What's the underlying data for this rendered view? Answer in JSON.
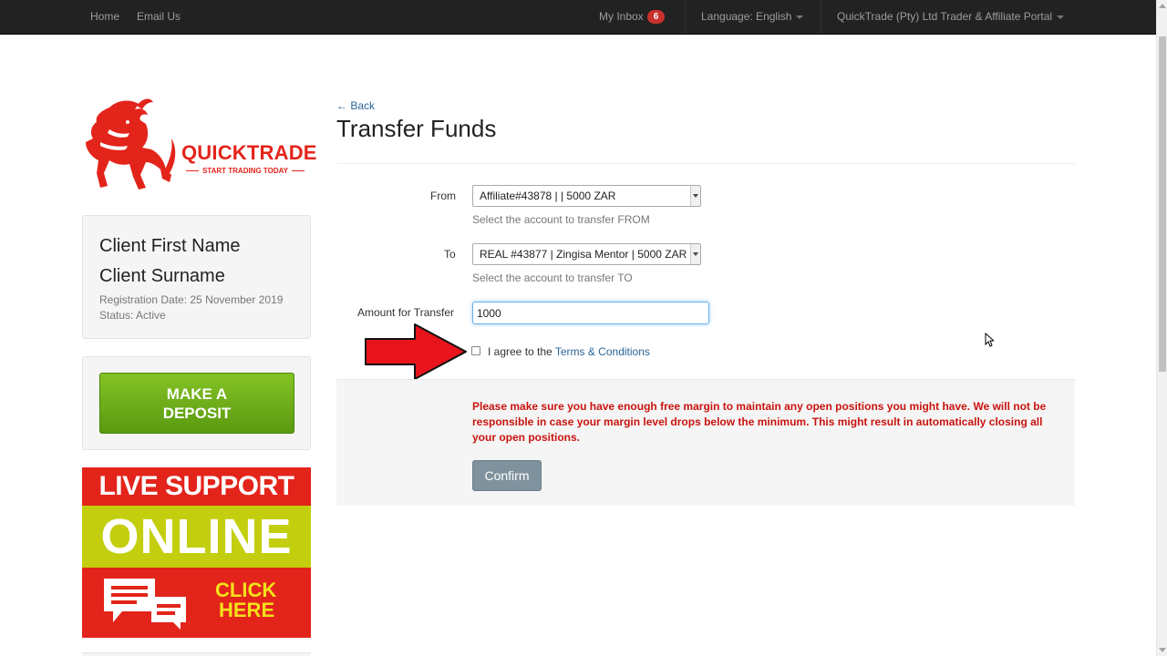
{
  "navbar": {
    "home": "Home",
    "email_us": "Email Us",
    "inbox_label": "My Inbox",
    "inbox_count": "6",
    "language": "Language: English",
    "portal": "QuickTrade (Pty) Ltd Trader & Affiliate Portal"
  },
  "sidebar": {
    "logo_text": "QUICKTRADE",
    "logo_tagline": "START TRADING TODAY",
    "client": {
      "first_name": "Client First Name",
      "surname": "Client Surname",
      "registration": "Registration Date: 25 November 2019",
      "status": "Status: Active"
    },
    "deposit_line1": "MAKE A",
    "deposit_line2": "DEPOSIT",
    "support_line1": "LIVE SUPPORT",
    "support_line2": "ONLINE",
    "support_click1": "CLICK",
    "support_click2": "HERE"
  },
  "main": {
    "back": "← Back",
    "title": "Transfer Funds",
    "from_label": "From",
    "from_value": "Affiliate#43878 | | 5000 ZAR",
    "from_help": "Select the account to transfer FROM",
    "to_label": "To",
    "to_value": "REAL #43877 | Zingisa Mentor | 5000 ZAR",
    "to_help": "Select the account to transfer TO",
    "amount_label": "Amount for Transfer",
    "amount_value": "1000",
    "agree_text": "I agree to the",
    "terms_link": "Terms & Conditions",
    "warning": "Please make sure you have enough free margin to maintain any open positions you might have. We will not be responsible in case your margin level drops below the minimum. This might result in automatically closing all your open positions.",
    "confirm": "Confirm"
  },
  "colors": {
    "brand_red": "#e3241b",
    "deposit_green": "#6aab17",
    "support_yellow": "#c3cf0e",
    "warning_red": "#c9140e",
    "link_blue": "#2a6496",
    "confirm_gray": "#7f929e"
  }
}
